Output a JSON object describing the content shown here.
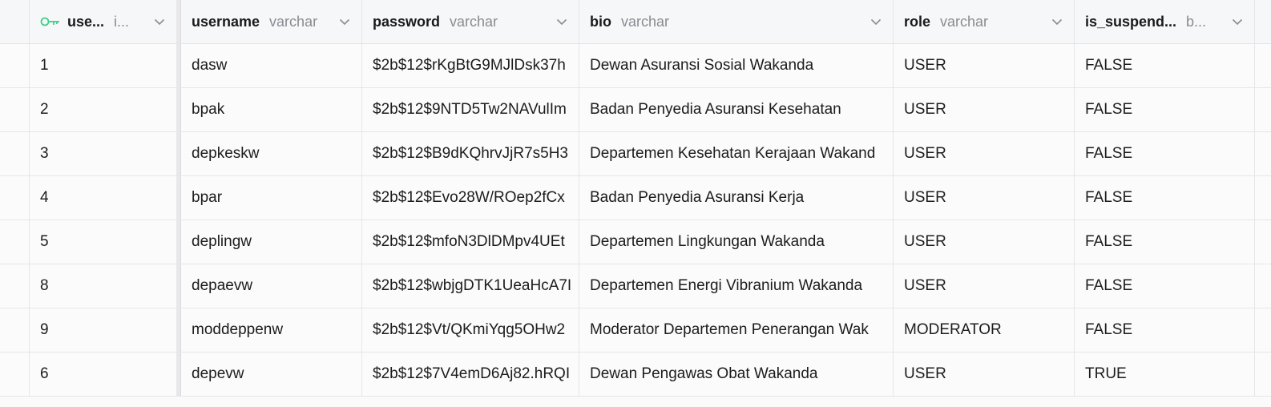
{
  "columns": [
    {
      "name": "use...",
      "type": "i...",
      "primary_key": true
    },
    {
      "name": "username",
      "type": "varchar"
    },
    {
      "name": "password",
      "type": "varchar"
    },
    {
      "name": "bio",
      "type": "varchar"
    },
    {
      "name": "role",
      "type": "varchar"
    },
    {
      "name": "is_suspend...",
      "type": "b..."
    }
  ],
  "rows": [
    {
      "id": "1",
      "username": "dasw",
      "password": "$2b$12$rKgBtG9MJlDsk37h",
      "bio": "Dewan Asuransi Sosial Wakanda",
      "role": "USER",
      "is_suspended": "FALSE"
    },
    {
      "id": "2",
      "username": "bpak",
      "password": "$2b$12$9NTD5Tw2NAVulIm",
      "bio": "Badan Penyedia Asuransi Kesehatan",
      "role": "USER",
      "is_suspended": "FALSE"
    },
    {
      "id": "3",
      "username": "depkeskw",
      "password": "$2b$12$B9dKQhrvJjR7s5H3",
      "bio": "Departemen Kesehatan Kerajaan Wakand",
      "role": "USER",
      "is_suspended": "FALSE"
    },
    {
      "id": "4",
      "username": "bpar",
      "password": "$2b$12$Evo28W/ROep2fCx",
      "bio": "Badan Penyedia Asuransi Kerja",
      "role": "USER",
      "is_suspended": "FALSE"
    },
    {
      "id": "5",
      "username": "deplingw",
      "password": "$2b$12$mfoN3DlDMpv4UEt",
      "bio": "Departemen Lingkungan Wakanda",
      "role": "USER",
      "is_suspended": "FALSE"
    },
    {
      "id": "8",
      "username": "depaevw",
      "password": "$2b$12$wbjgDTK1UeaHcA7I",
      "bio": "Departemen Energi Vibranium Wakanda",
      "role": "USER",
      "is_suspended": "FALSE"
    },
    {
      "id": "9",
      "username": "moddeppenw",
      "password": "$2b$12$Vt/QKmiYqg5OHw2",
      "bio": "Moderator Departemen Penerangan Wak",
      "role": "MODERATOR",
      "is_suspended": "FALSE"
    },
    {
      "id": "6",
      "username": "depevw",
      "password": "$2b$12$7V4emD6Aj82.hRQI",
      "bio": "Dewan Pengawas Obat Wakanda",
      "role": "USER",
      "is_suspended": "TRUE"
    }
  ],
  "colors": {
    "key_icon": "#3ecf8e",
    "header_bg": "#f6f7f8",
    "row_bg": "#fbfbfc",
    "type_text": "#8b8b93"
  },
  "icons": {
    "primary_key": "key-icon",
    "column_menu": "chevron-down-icon"
  }
}
